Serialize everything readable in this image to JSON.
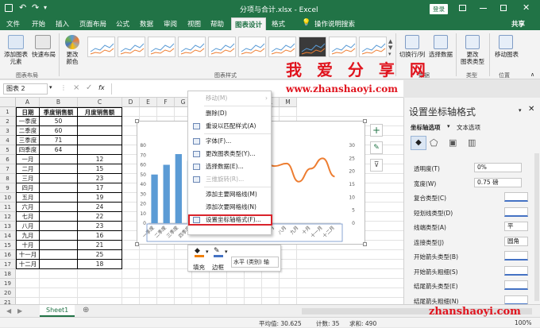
{
  "window": {
    "title": "分项与合计.xlsx - Excel",
    "login": "登录",
    "share": "共享",
    "tell_me": "操作说明搜索"
  },
  "tabs": [
    "文件",
    "开始",
    "插入",
    "页面布局",
    "公式",
    "数据",
    "审阅",
    "视图",
    "帮助",
    "图表设计",
    "格式"
  ],
  "active_tab": "图表设计",
  "ribbon": {
    "add_chart_element": "添加图表\n元素",
    "quick_layout": "快速布局",
    "change_colors": "更改\n颜色",
    "group_layouts": "图表布局",
    "group_styles": "图表样式",
    "switch_row_col": "切换行/列",
    "select_data": "选择数据",
    "group_data": "数据",
    "change_chart_type": "更改\n图表类型",
    "group_type": "类型",
    "move_chart": "移动图表",
    "group_location": "位置"
  },
  "formula_bar": {
    "name_box": "图表 2",
    "fx": "fx",
    "cancel": "×",
    "enter": "✓"
  },
  "columns": [
    "A",
    "B",
    "C",
    "D",
    "E",
    "F",
    "G",
    "H",
    "I",
    "J",
    "K",
    "L",
    "M"
  ],
  "rows": [
    "1",
    "2",
    "3",
    "4",
    "5",
    "6",
    "7",
    "8",
    "9",
    "10",
    "11",
    "12",
    "13",
    "14",
    "15",
    "16",
    "17",
    "18",
    "19",
    "20",
    "21"
  ],
  "table": {
    "headers": [
      "日期",
      "季度销售额",
      "月度销售额"
    ],
    "rows": [
      [
        "一季度",
        "50",
        ""
      ],
      [
        "二季度",
        "60",
        ""
      ],
      [
        "三季度",
        "71",
        ""
      ],
      [
        "四季度",
        "64",
        ""
      ],
      [
        "一月",
        "",
        "12"
      ],
      [
        "二月",
        "",
        "15"
      ],
      [
        "三月",
        "",
        "23"
      ],
      [
        "四月",
        "",
        "17"
      ],
      [
        "五月",
        "",
        "19"
      ],
      [
        "六月",
        "",
        "24"
      ],
      [
        "七月",
        "",
        "22"
      ],
      [
        "八月",
        "",
        "23"
      ],
      [
        "九月",
        "",
        "16"
      ],
      [
        "十月",
        "",
        "21"
      ],
      [
        "十一月",
        "",
        "25"
      ],
      [
        "十二月",
        "",
        "18"
      ]
    ]
  },
  "chart_data": {
    "type": "bar",
    "categories": [
      "一季度",
      "二季度",
      "三季度",
      "四季度",
      "一月",
      "二月",
      "三月",
      "四月",
      "五月",
      "六月",
      "七月",
      "八月",
      "九月",
      "十月",
      "十一月",
      "十二月"
    ],
    "series": [
      {
        "values": [
          50,
          60,
          71,
          64,
          null,
          null,
          null,
          null,
          null,
          null,
          null,
          null,
          null,
          null,
          null,
          null
        ],
        "color": "#5b9bd5",
        "type": "bar"
      },
      {
        "values": [
          null,
          null,
          null,
          null,
          12,
          15,
          23,
          17,
          19,
          24,
          22,
          23,
          16,
          21,
          25,
          18
        ],
        "color": "#ed7d31",
        "type": "line"
      }
    ],
    "y_left_visible_ticks": [
      "80",
      "70",
      "60",
      "50",
      "40",
      "30",
      "20",
      "10",
      "0"
    ],
    "y_right_ticks": [
      "30",
      "25",
      "20",
      "15",
      "10",
      "5",
      "0"
    ],
    "y_right_range": [
      0,
      30
    ],
    "y_left_range": [
      0,
      80
    ],
    "axis_caption_fragment": "销售额"
  },
  "context_menu": {
    "items": [
      {
        "label": "移动(M)",
        "disabled": true,
        "submenu": true,
        "icon": "none"
      },
      {
        "label": "删除(D)",
        "disabled": false,
        "icon": "none"
      },
      {
        "label": "重设以匹配样式(A)",
        "disabled": false,
        "icon": "reset-icon"
      },
      {
        "label": "字体(F)...",
        "disabled": false,
        "icon": "font-icon"
      },
      {
        "label": "更改图表类型(Y)...",
        "disabled": false,
        "icon": "chart-type-icon"
      },
      {
        "label": "选择数据(E)...",
        "disabled": false,
        "icon": "select-data-icon"
      },
      {
        "label": "三维旋转(R)...",
        "disabled": true,
        "icon": "rotate-3d-icon"
      },
      {
        "label": "添加主要网格线(M)",
        "disabled": false,
        "icon": "none"
      },
      {
        "label": "添加次要网格线(N)",
        "disabled": false,
        "icon": "none"
      },
      {
        "label": "设置坐标轴格式(F)...",
        "disabled": false,
        "highlighted": true,
        "icon": "format-axis-icon"
      }
    ]
  },
  "mini_toolbar": {
    "fill_label": "填充",
    "outline_label": "边框",
    "axis_select": "水平 (类别) 轴"
  },
  "format_pane": {
    "title": "设置坐标轴格式",
    "tab_axis_options": "坐标轴选项",
    "tab_text_options": "文本选项",
    "properties": [
      {
        "label": "透明度(T)",
        "value": "0%"
      },
      {
        "label": "宽度(W)",
        "value": "0.75 磅"
      },
      {
        "label": "复合类型(C)",
        "value": ""
      },
      {
        "label": "短划线类型(D)",
        "value": ""
      },
      {
        "label": "线端类型(A)",
        "value": "平"
      },
      {
        "label": "连接类型(J)",
        "value": "圆角"
      },
      {
        "label": "开始箭头类型(B)",
        "value": ""
      },
      {
        "label": "开始箭头粗细(S)",
        "value": ""
      },
      {
        "label": "结尾箭头类型(E)",
        "value": ""
      },
      {
        "label": "结尾箭头粗细(N)",
        "value": ""
      }
    ]
  },
  "sheet_tab": "Sheet1",
  "status": {
    "average": "平均值: 30.625",
    "count": "计数: 35",
    "sum": "求和: 490",
    "zoom": "100%"
  },
  "watermarks": {
    "cn": "我 爱 分 享 网",
    "url": "www.zhanshaoyi.com",
    "url_bottom": "zhanshaoyi.com"
  },
  "colors": {
    "excel_green": "#217346",
    "bar": "#5b9bd5",
    "line": "#ed7d31",
    "highlight_red": "#e0141e"
  }
}
